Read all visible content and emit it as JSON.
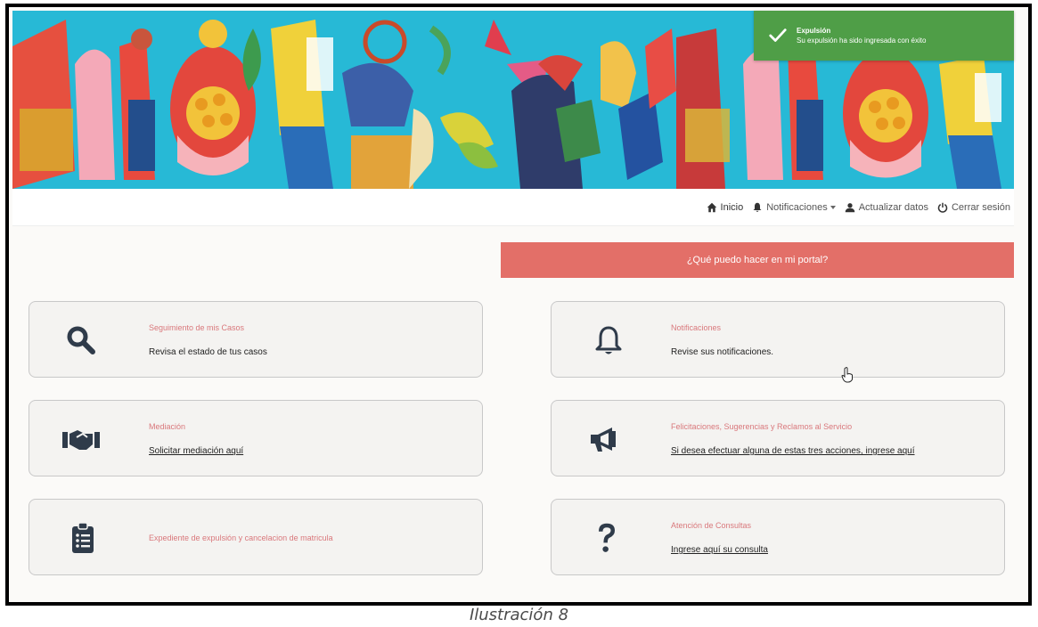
{
  "toast": {
    "title": "Expulsión",
    "message": "Su expulsión ha sido ingresada con éxito",
    "color": "#4f9e47"
  },
  "nav": {
    "home": "Inicio",
    "notifications": "Notificaciones",
    "update": "Actualizar datos",
    "logout": "Cerrar sesión"
  },
  "help_bar": {
    "label": "¿Qué puedo hacer en mi portal?",
    "color": "#e36f68"
  },
  "cards": {
    "cases": {
      "title": "Seguimiento de mis Casos",
      "desc": "Revisa el estado de tus casos",
      "icon": "search-icon"
    },
    "notif": {
      "title": "Notificaciones",
      "desc": "Revise sus notificaciones.",
      "icon": "bell-icon"
    },
    "mediation": {
      "title": "Mediación",
      "desc": "Solicitar mediación aquí",
      "icon": "handshake-icon"
    },
    "feedback": {
      "title": "Felicitaciones, Sugerencias y Reclamos al Servicio",
      "desc": "Si desea efectuar alguna de estas tres acciones, ingrese aquí",
      "icon": "megaphone-icon"
    },
    "expulsion": {
      "title": "Expediente de expulsión y cancelacion de matricula",
      "icon": "clipboard-list-icon"
    },
    "queries": {
      "title": "Atención de Consultas",
      "desc": "Ingrese aquí su consulta",
      "icon": "question-icon"
    }
  },
  "caption": "Ilustración 8",
  "colors": {
    "accent_title": "#d9787c",
    "icon_dark": "#2f3b4a"
  }
}
